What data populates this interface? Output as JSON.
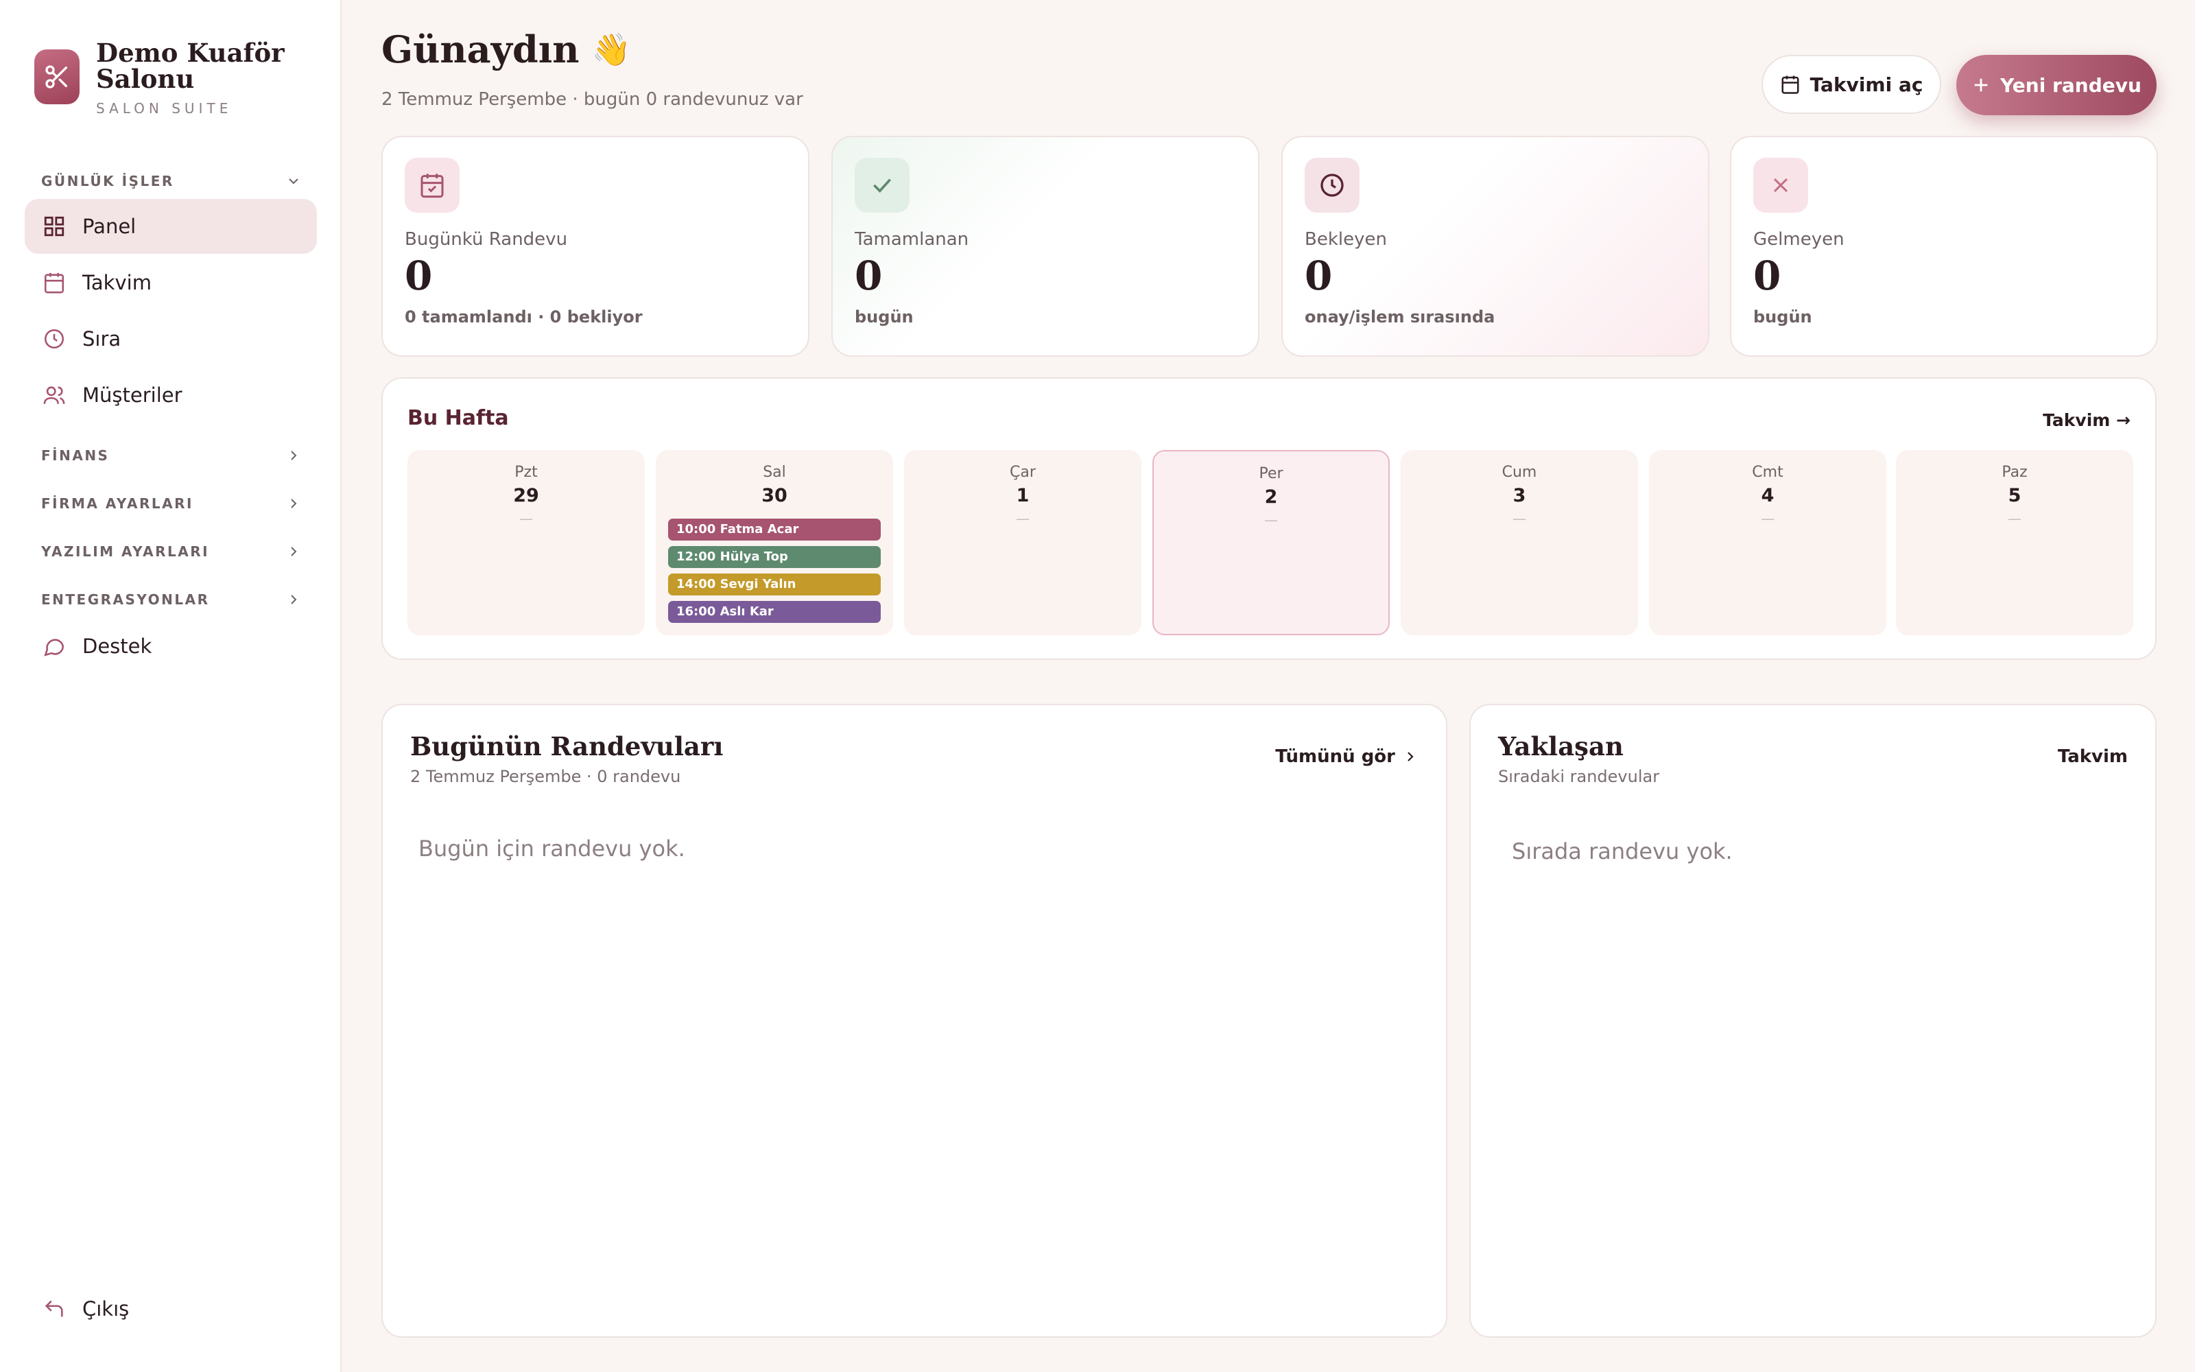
{
  "brand": {
    "name": "Demo Kuaför Salonu",
    "subtitle": "SALON SUITE"
  },
  "sidebar": {
    "groups": {
      "daily": "GÜNLÜK İŞLER",
      "finance": "FİNANS",
      "company": "FİRMA AYARLARI",
      "software": "YAZILIM AYARLARI",
      "integrations": "ENTEGRASYONLAR"
    },
    "items": {
      "panel": "Panel",
      "calendar": "Takvim",
      "queue": "Sıra",
      "customers": "Müşteriler",
      "support": "Destek",
      "logout": "Çıkış"
    }
  },
  "header": {
    "greeting": "Günaydın",
    "wave": "👋",
    "subline": "2 Temmuz Perşembe · bugün 0 randevunuz var",
    "open_calendar": "Takvimi aç",
    "new_appointment": "Yeni randevu"
  },
  "stats": [
    {
      "label": "Bugünkü Randevu",
      "value": "0",
      "note": "0 tamamlandı · 0 bekliyor"
    },
    {
      "label": "Tamamlanan",
      "value": "0",
      "note": "bugün"
    },
    {
      "label": "Bekleyen",
      "value": "0",
      "note": "onay/işlem sırasında"
    },
    {
      "label": "Gelmeyen",
      "value": "0",
      "note": "bugün"
    }
  ],
  "week": {
    "title": "Bu Hafta",
    "link": "Takvim →",
    "empty_mark": "—",
    "days": [
      {
        "name": "Pzt",
        "num": "29"
      },
      {
        "name": "Sal",
        "num": "30"
      },
      {
        "name": "Çar",
        "num": "1"
      },
      {
        "name": "Per",
        "num": "2"
      },
      {
        "name": "Cum",
        "num": "3"
      },
      {
        "name": "Cmt",
        "num": "4"
      },
      {
        "name": "Paz",
        "num": "5"
      }
    ],
    "appointments": [
      {
        "label": "10:00 Fatma Acar",
        "color": "#a65470"
      },
      {
        "label": "12:00 Hülya Top",
        "color": "#5e8a6f"
      },
      {
        "label": "14:00 Sevgi Yalın",
        "color": "#c49a2a"
      },
      {
        "label": "16:00 Aslı Kar",
        "color": "#7a5a98"
      }
    ]
  },
  "today_panel": {
    "title": "Bugünün Randevuları",
    "subtitle": "2 Temmuz Perşembe · 0 randevu",
    "link": "Tümünü gör",
    "empty": "Bugün için randevu yok."
  },
  "upcoming_panel": {
    "title": "Yaklaşan",
    "subtitle": "Sıradaki randevular",
    "link": "Takvim",
    "empty": "Sırada randevu yok."
  }
}
